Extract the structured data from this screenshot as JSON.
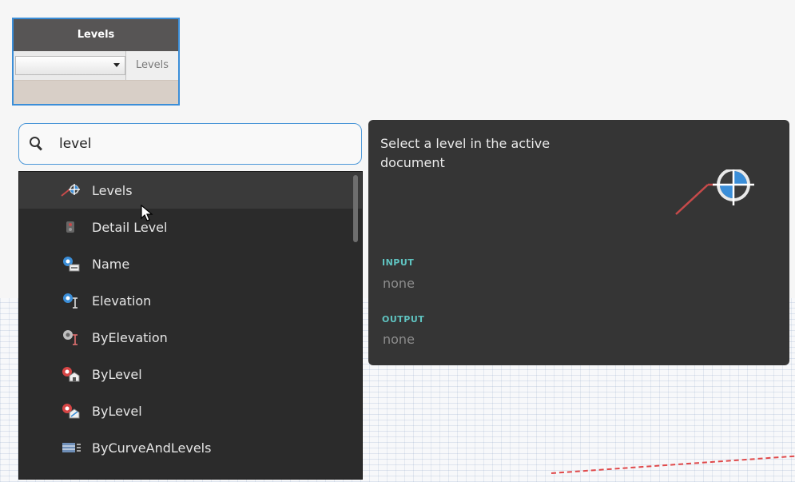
{
  "node": {
    "title": "Levels",
    "output_port": "Levels",
    "selected_value": ""
  },
  "search": {
    "value": "level",
    "placeholder": ""
  },
  "results": [
    {
      "label": "Levels",
      "icon": "levels-icon",
      "selected": true
    },
    {
      "label": "Detail Level",
      "icon": "detail-level-icon"
    },
    {
      "label": "Name",
      "icon": "name-icon"
    },
    {
      "label": "Elevation",
      "icon": "elevation-icon"
    },
    {
      "label": "ByElevation",
      "icon": "by-elevation-icon"
    },
    {
      "label": "ByLevel",
      "icon": "by-level-icon"
    },
    {
      "label": "ByLevel",
      "icon": "by-level-icon-2"
    },
    {
      "label": "ByCurveAndLevels",
      "icon": "by-curve-and-levels-icon"
    }
  ],
  "tooltip": {
    "description": "Select a level in the active document",
    "input_label": "INPUT",
    "input_value": "none",
    "output_label": "OUTPUT",
    "output_value": "none"
  },
  "colors": {
    "accent_blue": "#3b8ed8",
    "section_label": "#5fc3c0",
    "panel_bg": "#353535",
    "list_bg": "#2b2b2b",
    "node_header": "#575555"
  }
}
